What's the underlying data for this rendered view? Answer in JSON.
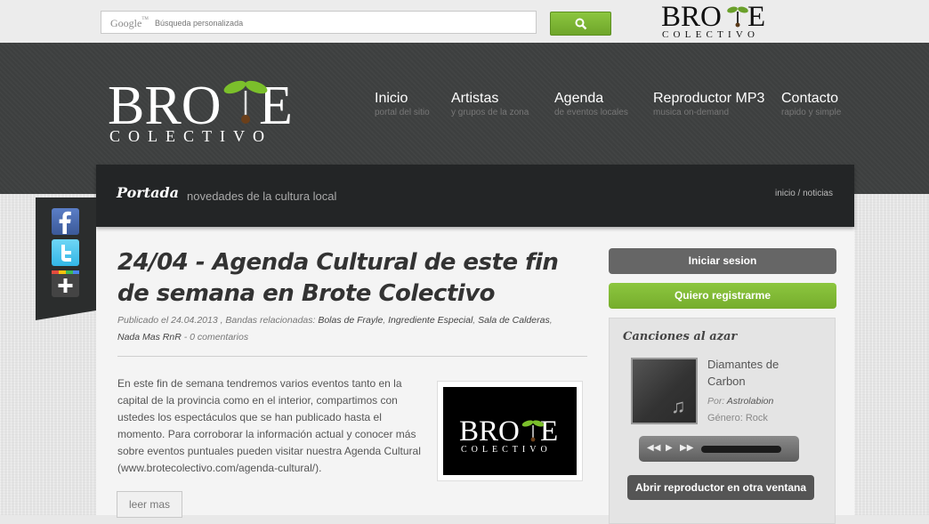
{
  "search": {
    "google_wordmark": "Google",
    "google_tm": "TM",
    "placeholder": "Búsqueda personalizada"
  },
  "brand": {
    "logo_top": "BRO",
    "logo_top_end": "E",
    "logo_bottom": "COLECTIVO",
    "accent_color": "#8cc63f",
    "header_color": "#3e4040"
  },
  "nav": [
    {
      "label": "Inicio",
      "sub": "portal del sitio"
    },
    {
      "label": "Artistas",
      "sub": "y grupos de la zona"
    },
    {
      "label": "Agenda",
      "sub": "de eventos locales"
    },
    {
      "label": "Reproductor MP3",
      "sub": "musica on-demand"
    },
    {
      "label": "Contacto",
      "sub": "rapido y simple"
    }
  ],
  "page": {
    "title": "Portada",
    "subtitle": "novedades de la cultura local",
    "breadcrumb": "inicio / noticias"
  },
  "social": [
    {
      "icon": "facebook-icon"
    },
    {
      "icon": "twitter-icon"
    },
    {
      "icon": "googleplus-icon"
    }
  ],
  "article": {
    "title": "24/04 - Agenda Cultural de este fin de semana en Brote Colectivo",
    "meta_prefix": "Publicado el 24.04.2013 , Bandas relacionadas: ",
    "bands": [
      "Bolas de Frayle",
      "Ingrediente Especial",
      "Sala de Calderas",
      "Nada Mas RnR"
    ],
    "comments": "0 comentarios",
    "body": "En este fin de semana tendremos varios eventos tanto en la capital de la provincia como en el interior, compartimos con ustedes los espectáculos que se han publicado hasta el momento. Para corroborar la información actual y conocer más sobre eventos puntuales pueden visitar nuestra Agenda Cultural (www.brotecolectivo.com/agenda-cultural/).",
    "read_more": "leer mas"
  },
  "sidebar": {
    "login": "Iniciar sesion",
    "register": "Quiero registrarme",
    "random_title": "Canciones al azar",
    "song": {
      "title": "Diamantes de Carbon",
      "artist_label": "Por:",
      "artist": "Astrolabion",
      "genre_label": "Género:",
      "genre": "Rock"
    },
    "player": {
      "rewind": "◀◀",
      "play": "▶",
      "forward": "▶▶"
    },
    "open_player": "Abrir reproductor en otra ventana"
  }
}
